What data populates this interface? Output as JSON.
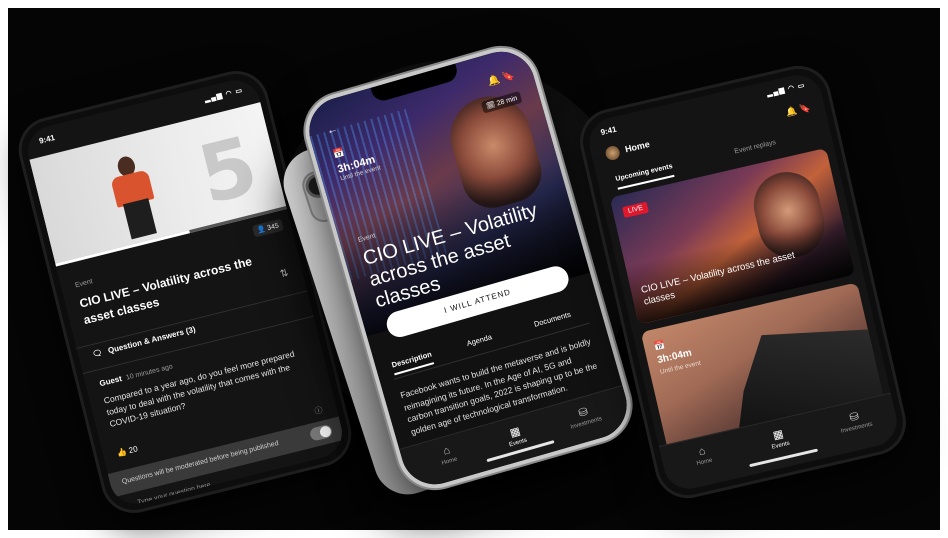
{
  "left_phone": {
    "time": "9:41",
    "viewers": "345",
    "event_label": "Event",
    "title": "CIO LIVE – Volatility across the asset classes",
    "qa_header": "Question & Answers (3)",
    "guest_name": "Guest",
    "guest_time": "10 minutes ago",
    "question": "Compared to a year ago, do you feel more prepared today to deal with the volatility that comes with the COVID-19 situation?",
    "likes": "20",
    "moderation_note": "Questions will be moderated before being published",
    "input_placeholder": "Type your question here..."
  },
  "center_phone": {
    "countdown": "3h:04m",
    "countdown_sub": "Until the event",
    "duration": "28 min",
    "event_label": "Event",
    "title": "CIO LIVE – Volatility across the asset classes",
    "attend_button": "I WILL ATTEND",
    "tabs": [
      "Description",
      "Agenda",
      "Documents"
    ],
    "description": "Facebook wants to build the metaverse and is boldly reimagining its future. In the Age of AI, 5G and carbon transition goals, 2022 is shaping up to be the golden age of technological transformation.",
    "nav": [
      "Home",
      "Events",
      "Investments"
    ]
  },
  "right_phone": {
    "time": "9:41",
    "header": "Home",
    "tabs": [
      "Upcoming events",
      "Event replays"
    ],
    "live_badge": "LIVE",
    "card1_title": "CIO LIVE – Volatility across the asset classes",
    "card2_countdown": "3h:04m",
    "card2_sub": "Until the event",
    "nav": [
      "Home",
      "Events",
      "Investments"
    ]
  },
  "colors": {
    "background": "#050505",
    "accent_red": "#e0182d",
    "text": "#ffffff"
  }
}
